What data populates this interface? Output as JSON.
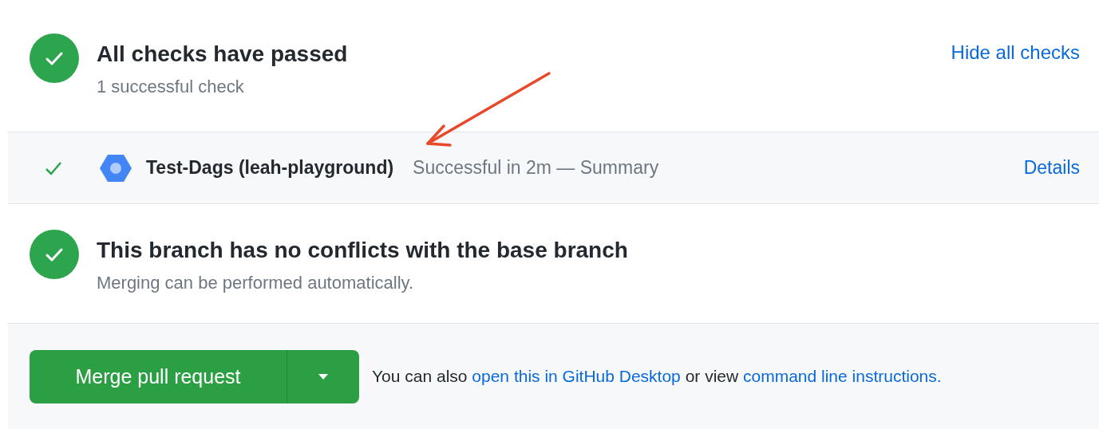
{
  "checks_summary": {
    "title": "All checks have passed",
    "subtitle": "1 successful check",
    "toggle_link": "Hide all checks"
  },
  "checks": [
    {
      "name": "Test-Dags (leah-playground)",
      "status": "Successful in 2m — Summary",
      "link": "Details",
      "passed": true
    }
  ],
  "merge_status": {
    "title": "This branch has no conflicts with the base branch",
    "subtitle": "Merging can be performed automatically."
  },
  "merge_button": {
    "label": "Merge pull request"
  },
  "footer_note": [
    {
      "kind": "text",
      "text": "You can also "
    },
    {
      "kind": "link",
      "text": "open this in GitHub Desktop"
    },
    {
      "kind": "text",
      "text": " or view "
    },
    {
      "kind": "link",
      "text": "command line instructions."
    }
  ]
}
